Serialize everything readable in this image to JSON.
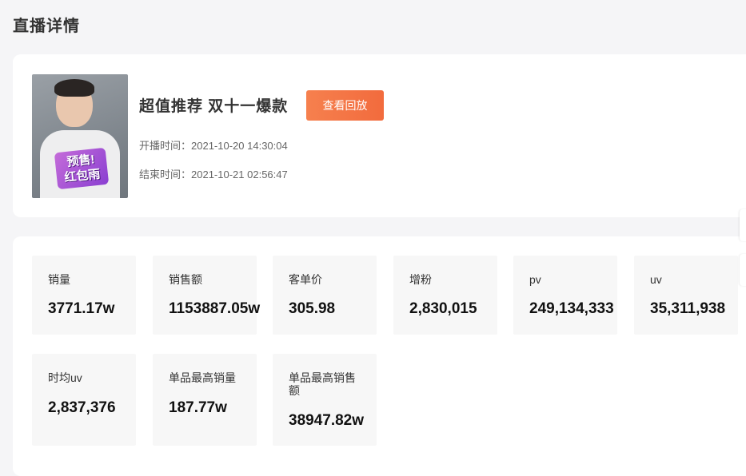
{
  "page": {
    "title": "直播详情"
  },
  "live": {
    "title": "超值推荐 双十一爆款",
    "replay_button": "查看回放",
    "start_label": "开播时间：",
    "start_time": "2021-10-20 14:30:04",
    "end_label": "结束时间：",
    "end_time": "2021-10-21 02:56:47",
    "cover_badge": [
      "预售!",
      "红包雨"
    ]
  },
  "stats": [
    {
      "label": "销量",
      "value": "3771.17w"
    },
    {
      "label": "销售额",
      "value": "1153887.05w"
    },
    {
      "label": "客单价",
      "value": "305.98"
    },
    {
      "label": "增粉",
      "value": "2,830,015"
    },
    {
      "label": "pv",
      "value": "249,134,333"
    },
    {
      "label": "uv",
      "value": "35,311,938"
    },
    {
      "label": "时均uv",
      "value": "2,837,376"
    },
    {
      "label": "单品最高销量",
      "value": "187.77w"
    },
    {
      "label": "单品最高销售额",
      "value": "38947.82w"
    }
  ],
  "colors": {
    "accent": "#f26b3d",
    "tile_bg": "#f7f7f7",
    "page_bg": "#f5f5f7"
  }
}
